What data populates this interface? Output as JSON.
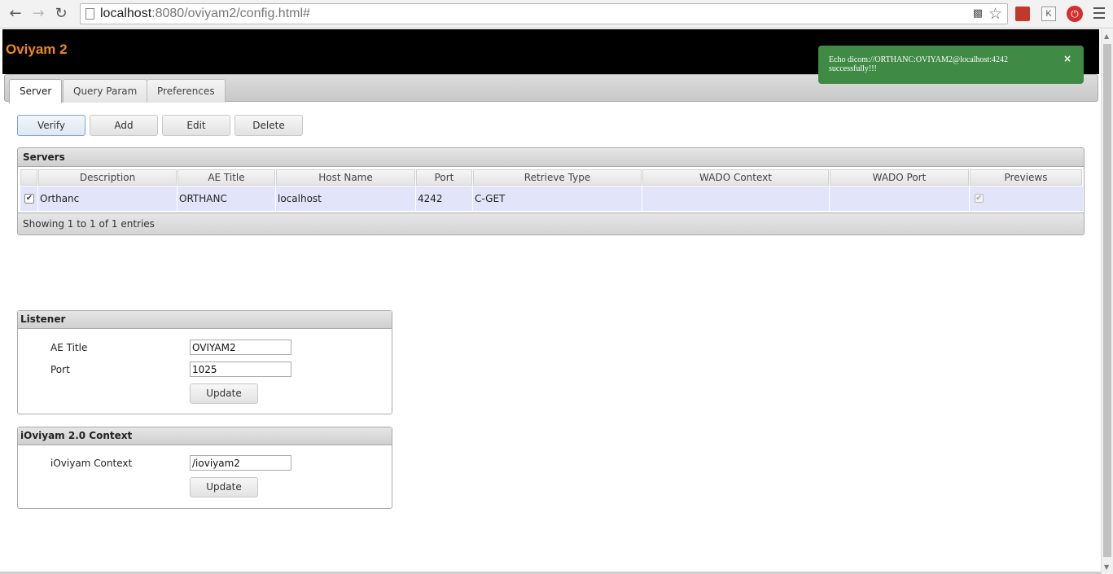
{
  "browser": {
    "url_host": "localhost",
    "url_rest": ":8080/oviyam2/config.html#",
    "ext_k_label": "K"
  },
  "app": {
    "title": "Oviyam 2"
  },
  "tabs": [
    {
      "label": "Server"
    },
    {
      "label": "Query Param"
    },
    {
      "label": "Preferences"
    }
  ],
  "toolbar": {
    "verify_label": "Verify",
    "add_label": "Add",
    "edit_label": "Edit",
    "delete_label": "Delete"
  },
  "servers": {
    "title": "Servers",
    "columns": [
      "Description",
      "AE Title",
      "Host Name",
      "Port",
      "Retrieve Type",
      "WADO Context",
      "WADO Port",
      "Previews"
    ],
    "rows": [
      {
        "selected": true,
        "description": "Orthanc",
        "ae_title": "ORTHANC",
        "host": "localhost",
        "port": "4242",
        "retrieve_type": "C-GET",
        "wado_context": "",
        "wado_port": "",
        "previews": true
      }
    ],
    "footer": "Showing 1 to 1 of 1 entries"
  },
  "listener": {
    "title": "Listener",
    "ae_title_label": "AE Title",
    "ae_title_value": "OVIYAM2",
    "port_label": "Port",
    "port_value": "1025",
    "update_label": "Update"
  },
  "ioviyam": {
    "title": "iOviyam 2.0 Context",
    "context_label": "iOviyam Context",
    "context_value": "/ioviyam2",
    "update_label": "Update"
  },
  "toast": {
    "line1": "Echo dicom://ORTHANC:OVIYAM2@localhost:4242",
    "line2": "successfully!!!",
    "close": "×",
    "color": "#3f8a44"
  },
  "colors": {
    "brand": "#f08a16",
    "selected_row": "#e2e4fa",
    "header_bg": "#000000"
  }
}
